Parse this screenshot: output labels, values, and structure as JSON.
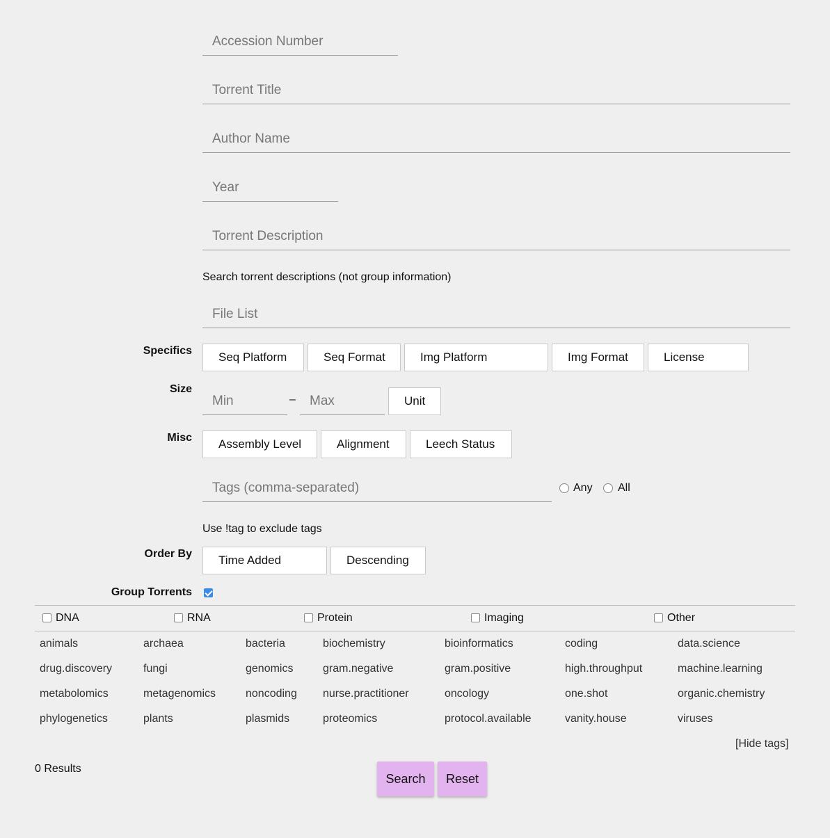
{
  "fields": {
    "accession": "Accession Number",
    "title": "Torrent Title",
    "author": "Author Name",
    "year": "Year",
    "description": "Torrent Description",
    "file_list": "File List",
    "size_min": "Min",
    "size_max": "Max",
    "tags": "Tags (comma-separated)"
  },
  "notes": {
    "description_hint": "Search torrent descriptions (not group information)",
    "tags_hint": "Use !tag to exclude tags",
    "size_dash": "–"
  },
  "labels": {
    "specifics": "Specifics",
    "size": "Size",
    "misc": "Misc",
    "order_by": "Order By",
    "group_torrents": "Group Torrents"
  },
  "specifics": [
    "Seq Platform",
    "Seq Format",
    "Img Platform",
    "Img Format",
    "License"
  ],
  "size_unit": "Unit",
  "misc": [
    "Assembly Level",
    "Alignment",
    "Leech Status"
  ],
  "tag_mode": {
    "any": "Any",
    "all": "All"
  },
  "order": {
    "field": "Time Added",
    "direction": "Descending"
  },
  "group_torrents_checked": true,
  "categories": [
    "DNA",
    "RNA",
    "Protein",
    "Imaging",
    "Other"
  ],
  "tags": [
    [
      "animals",
      "archaea",
      "bacteria",
      "biochemistry",
      "bioinformatics",
      "coding",
      "data.science"
    ],
    [
      "drug.discovery",
      "fungi",
      "genomics",
      "gram.negative",
      "gram.positive",
      "high.throughput",
      "machine.learning"
    ],
    [
      "metabolomics",
      "metagenomics",
      "noncoding",
      "nurse.practitioner",
      "oncology",
      "one.shot",
      "organic.chemistry"
    ],
    [
      "phylogenetics",
      "plants",
      "plasmids",
      "proteomics",
      "protocol.available",
      "vanity.house",
      "viruses"
    ]
  ],
  "hide_tags": "[Hide tags]",
  "results": "0 Results",
  "buttons": {
    "search": "Search",
    "reset": "Reset"
  },
  "colors": {
    "action_button": "#e2b3ee",
    "checkbox_checked": "#3b8ae6",
    "background": "#efefef"
  }
}
